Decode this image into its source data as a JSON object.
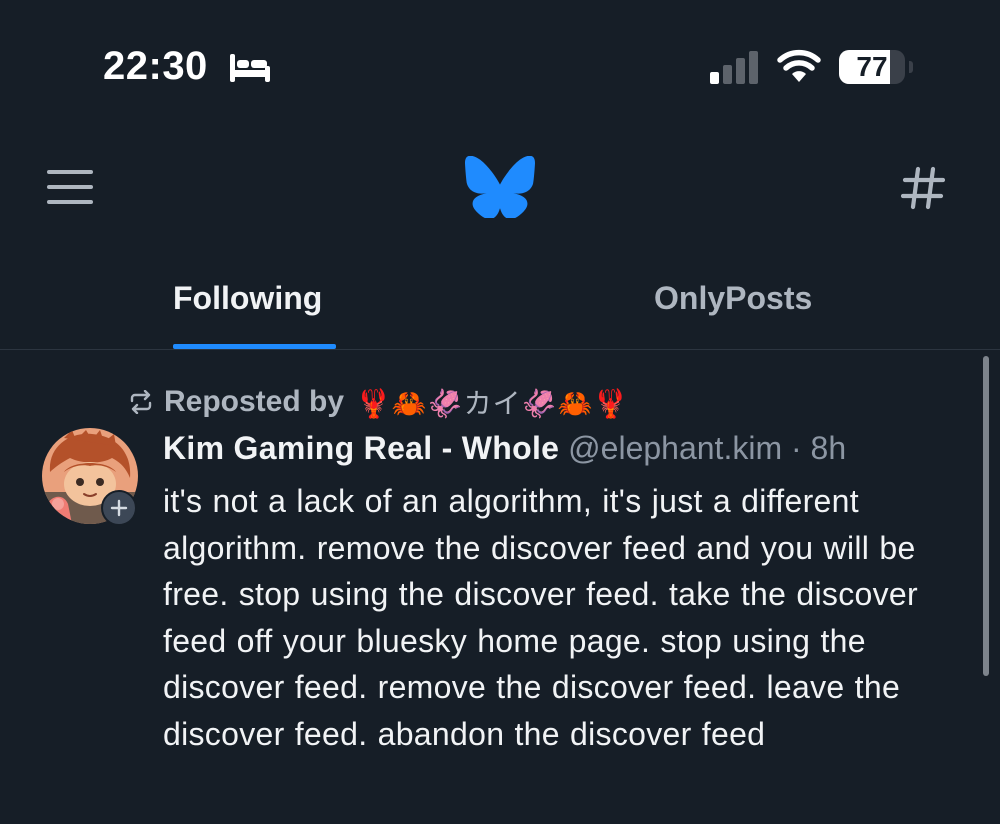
{
  "status_bar": {
    "time": "22:30",
    "focus_icon": "bed-icon",
    "signal_icon": "cellular-signal-icon",
    "wifi_icon": "wifi-icon",
    "battery_level": "77",
    "battery_fraction": 0.77
  },
  "header": {
    "menu_icon": "hamburger-menu-icon",
    "logo_icon": "bluesky-butterfly-icon",
    "feeds_icon": "hashtag-icon"
  },
  "tabs": [
    {
      "label": "Following",
      "active": true
    },
    {
      "label": "OnlyPosts",
      "active": false
    }
  ],
  "post": {
    "repost_icon": "repost-icon",
    "reposted_by_label": "Reposted by",
    "reposted_by_name": "🦞🦀🦑カイ🦑🦀🦞",
    "author_name": "Kim Gaming Real - Whole",
    "author_handle": "@elephant.kim",
    "separator": "·",
    "time_ago": "8h",
    "text": "it's not a lack of an algorithm, it's just a different algorithm. remove the discover feed and you will be free. stop using the discover feed. take the discover feed off your bluesky home page. stop using the discover feed. remove the discover feed. leave the discover feed. abandon the discover feed"
  },
  "colors": {
    "background": "#161e27",
    "accent": "#1f8bfe",
    "text_primary": "#f1f3f5",
    "text_secondary": "#aeb6c0",
    "text_muted": "#8c96a3"
  }
}
